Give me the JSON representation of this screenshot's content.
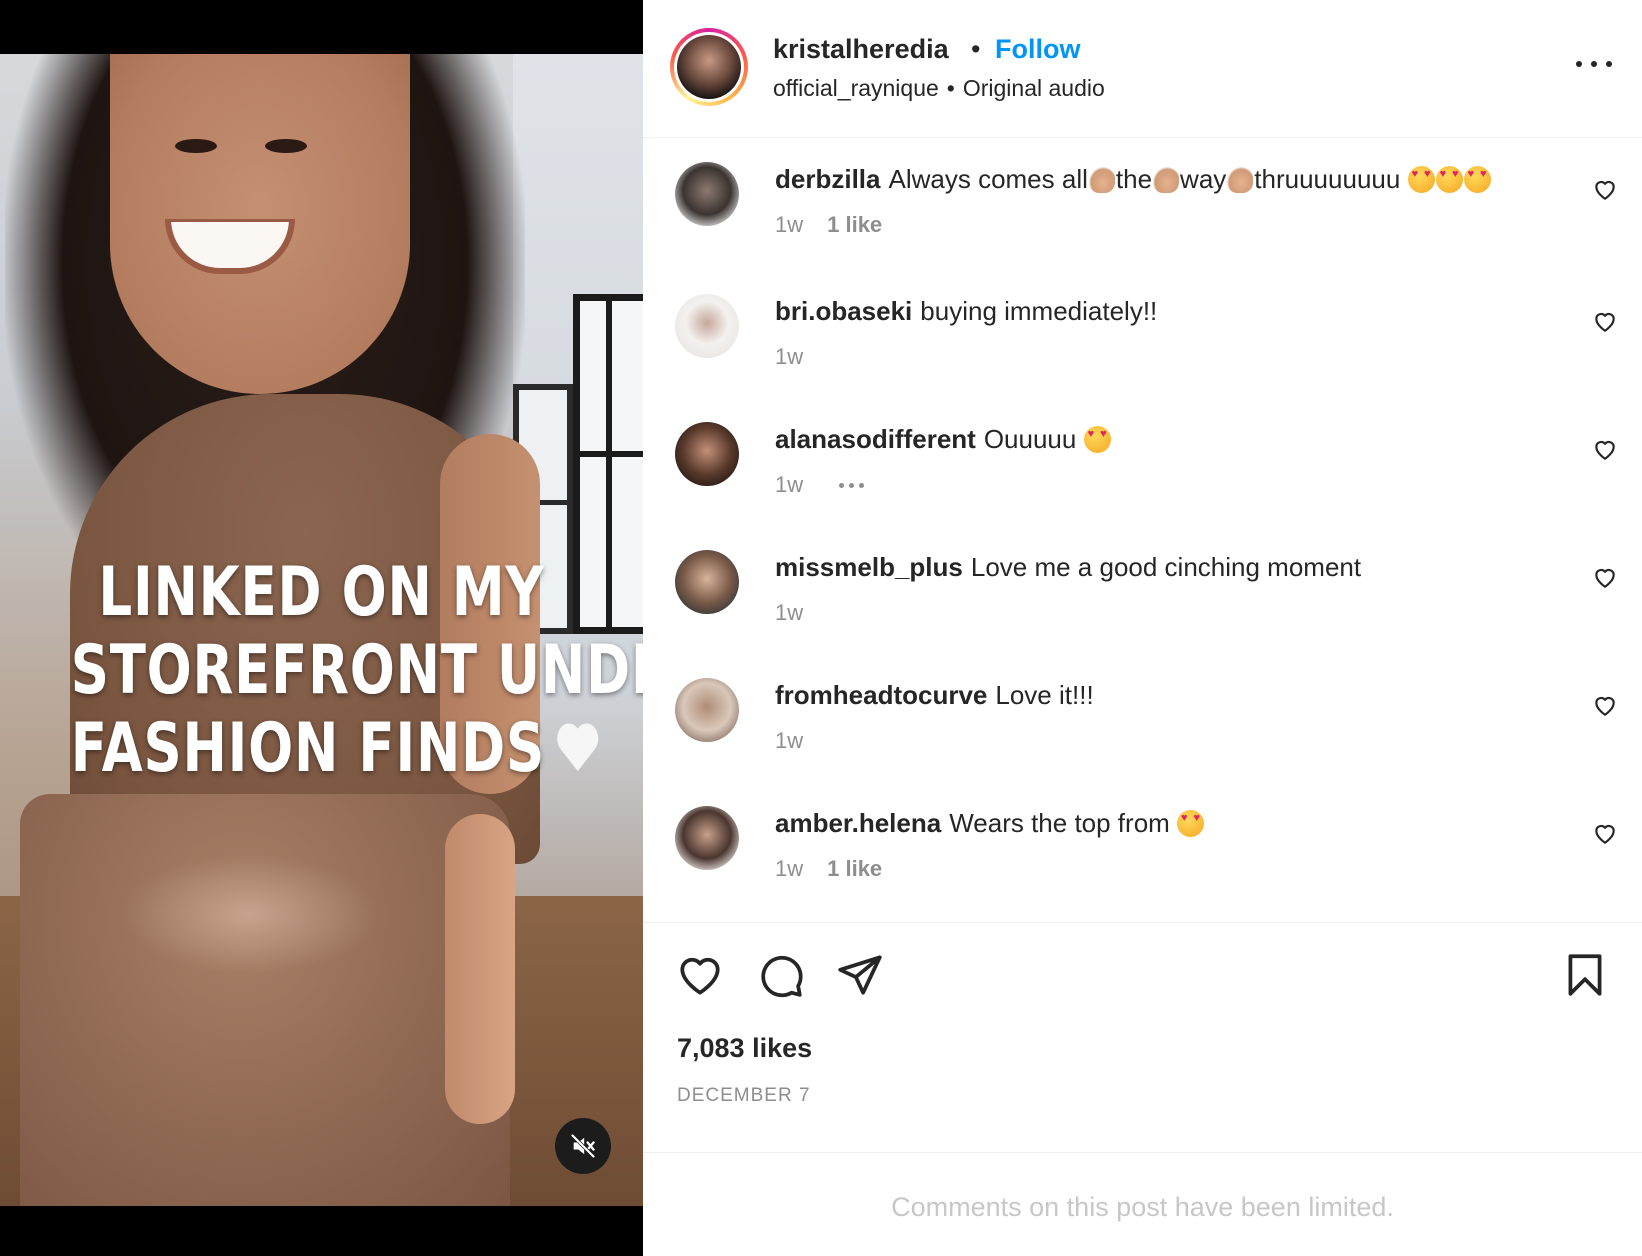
{
  "media": {
    "overlay_lines": [
      "LINKED ON MY",
      "STOREFRONT UNDER",
      "FASHION FINDS"
    ],
    "overlay_emoji_icon": "white-heart-emoji",
    "mute_icon": "speaker-muted-icon"
  },
  "header": {
    "username": "kristalheredia",
    "separator": "•",
    "follow_label": "Follow",
    "audio_user": "official_raynique",
    "audio_label": "Original audio",
    "more_icon": "more-options-icon"
  },
  "comments": [
    {
      "user": "derbzilla",
      "text_parts": [
        "Always comes all",
        "the",
        "way",
        "thruuuuuuuu"
      ],
      "time": "1w",
      "likes": "1 like"
    },
    {
      "user": "bri.obaseki",
      "text": "buying immediately!!",
      "time": "1w",
      "likes": ""
    },
    {
      "user": "alanasodifferent",
      "text": "Ouuuuu",
      "time": "1w",
      "likes": ""
    },
    {
      "user": "missmelb_plus",
      "text": "Love me a good cinching moment",
      "time": "1w",
      "likes": ""
    },
    {
      "user": "fromheadtocurve",
      "text": "Love it!!!",
      "time": "1w",
      "likes": ""
    },
    {
      "user": "amber.helena",
      "text": "Wears the top from",
      "time": "1w",
      "likes": "1 like"
    }
  ],
  "actions": {
    "like_icon": "heart-outline-icon",
    "comment_icon": "comment-bubble-icon",
    "share_icon": "paper-plane-icon",
    "save_icon": "bookmark-icon"
  },
  "likes_count": "7,083 likes",
  "date": "DECEMBER 7",
  "comments_limited": "Comments on this post have been limited.",
  "colors": {
    "follow_blue": "#0095f6",
    "muted_text": "#8e8e8e",
    "limited_text": "#c7c7c7",
    "primary_text": "#262626"
  }
}
